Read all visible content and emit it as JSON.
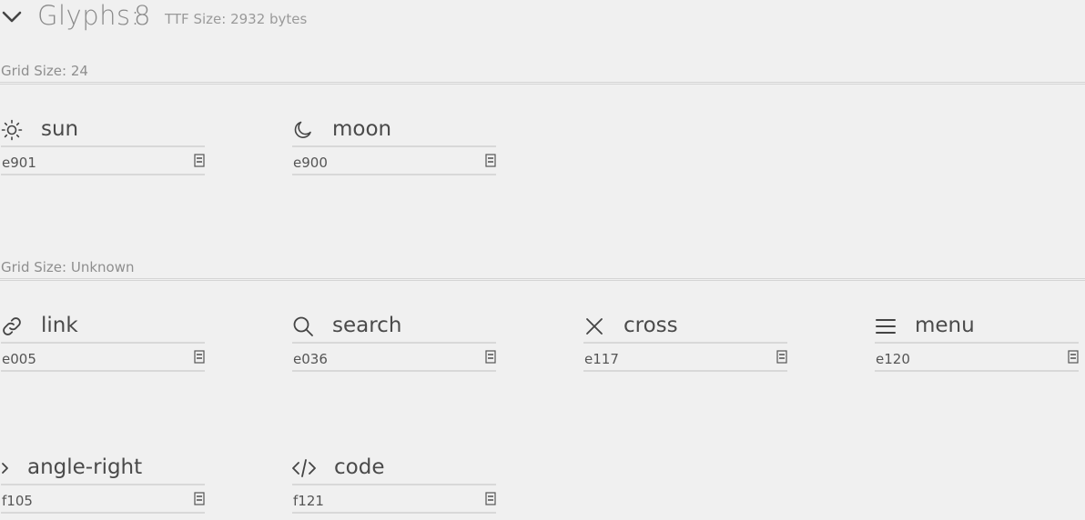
{
  "header": {
    "title_label": "Glyphs:",
    "title_count": "8",
    "ttf_size": "TTF Size: 2932 bytes"
  },
  "sections": [
    {
      "label": "Grid Size: 24",
      "glyphs": [
        {
          "name": "sun",
          "code": "e901",
          "icon": "sun-icon"
        },
        {
          "name": "moon",
          "code": "e900",
          "icon": "moon-icon"
        }
      ]
    },
    {
      "label": "Grid Size: Unknown",
      "glyphs": [
        {
          "name": "link",
          "code": "e005",
          "icon": "link-icon"
        },
        {
          "name": "search",
          "code": "e036",
          "icon": "search-icon"
        },
        {
          "name": "cross",
          "code": "e117",
          "icon": "cross-icon"
        },
        {
          "name": "menu",
          "code": "e120",
          "icon": "menu-icon"
        },
        {
          "name": "angle-right",
          "code": "f105",
          "icon": "angle-right-icon"
        },
        {
          "name": "code",
          "code": "f121",
          "icon": "code-icon"
        }
      ]
    }
  ],
  "colors": {
    "background": "#f0f0f0",
    "text": "#444444",
    "muted": "#8e8e8e",
    "line": "#d8d8d8"
  }
}
